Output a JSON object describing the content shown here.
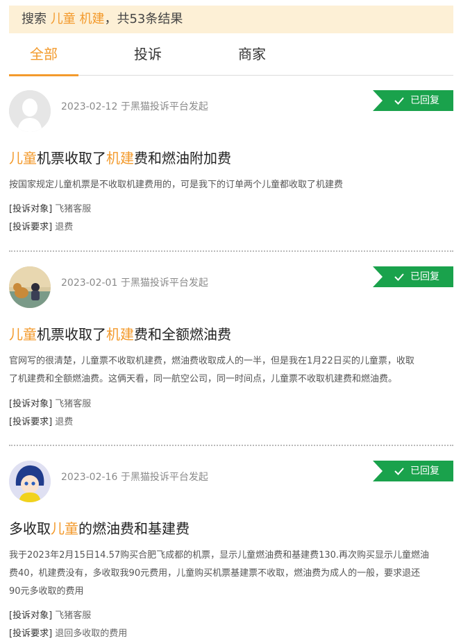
{
  "search": {
    "prefix": "搜索 ",
    "keyword": "儿童 机建",
    "suffix": "，共53条结果"
  },
  "tabs": [
    {
      "label": "全部"
    },
    {
      "label": "投诉"
    },
    {
      "label": "商家"
    }
  ],
  "colors": {
    "accent": "#f39a2c",
    "badge": "#1aa24c"
  },
  "labels": {
    "object": "[投诉对象]",
    "request": "[投诉要求]"
  },
  "complaints": [
    {
      "date": "2023-02-12",
      "source": "于黑猫投诉平台发起",
      "status": "已回复",
      "avatar_icon": "default-avatar-icon",
      "title_parts": [
        "儿童",
        "机票收取了",
        "机建",
        "费和燃油附加费"
      ],
      "description": "按国家规定儿童机票是不收取机建费用的，可是我下的订单两个儿童都收取了机建费",
      "object": "飞猪客服",
      "request": "退费"
    },
    {
      "date": "2023-02-01",
      "source": "于黑猫投诉平台发起",
      "status": "已回复",
      "avatar_icon": "child-with-dog-avatar-icon",
      "title_parts": [
        "儿童",
        "机票收取了",
        "机建",
        "费和全额燃油费"
      ],
      "description_lines": [
        "官网写的很清楚，儿童票不收取机建费，燃油费收取成人的一半，但是我在1月22日买的儿童票，收取",
        "了机建费和全额燃油费。这俩天看，同一航空公司，同一时间点，儿童票不收取机建费和燃油费。"
      ],
      "object": "飞猪客服",
      "request": "退费"
    },
    {
      "date": "2023-02-16",
      "source": "于黑猫投诉平台发起",
      "status": "已回复",
      "avatar_icon": "cartoon-girl-avatar-icon",
      "title_parts": [
        "多收取",
        "儿童",
        "的燃油费和基建费"
      ],
      "description_lines": [
        "我于2023年2月15日14.57购买合肥飞成都的机票，显示儿童燃油费和基建费130.再次购买显示儿童燃油",
        "费40，机建费没有，多收取我90元费用，儿童购买机票基建票不收取，燃油费为成人的一般，要求退还",
        "90元多收取的费用"
      ],
      "object": "飞猪客服",
      "request": "退回多收取的费用"
    }
  ]
}
